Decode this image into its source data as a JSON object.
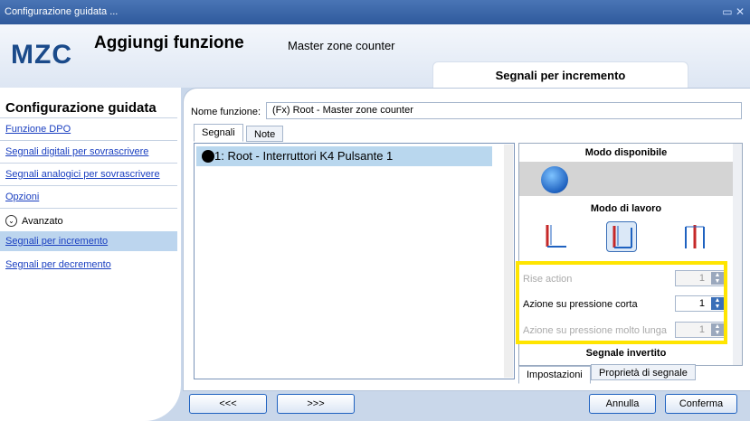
{
  "window": {
    "title": "Configurazione guidata ..."
  },
  "header": {
    "logo": "MZC",
    "title": "Aggiungi funzione",
    "subtitle": "Master zone counter",
    "step": "Segnali per incremento"
  },
  "sidebar": {
    "title": "Configurazione guidata",
    "items": [
      "Funzione DPO",
      "Segnali digitali per sovrascrivere",
      "Segnali analogici per sovrascrivere",
      "Opzioni"
    ],
    "advanced": "Avanzato",
    "advanced_items": [
      "Segnali per incremento",
      "Segnali per decremento"
    ]
  },
  "form": {
    "name_label": "Nome funzione:",
    "name_value": "(Fx) Root - Master zone counter"
  },
  "tabs": [
    "Segnali",
    "Note"
  ],
  "tree": {
    "row": "1: Root - Interruttori K4 Pulsante 1"
  },
  "panel": {
    "modo_disponibile": "Modo disponibile",
    "modo_lavoro": "Modo di lavoro",
    "fields": [
      {
        "label": "Rise action",
        "value": "1",
        "enabled": false
      },
      {
        "label": "Azione su pressione corta",
        "value": "1",
        "enabled": true
      },
      {
        "label": "Azione su pressione molto lunga",
        "value": "1",
        "enabled": false
      }
    ],
    "segnale": "Segnale invertito",
    "tabs": [
      "Impostazioni",
      "Proprietà di segnale"
    ]
  },
  "footer": {
    "prev": "<<<",
    "next": ">>>",
    "cancel": "Annulla",
    "confirm": "Conferma"
  },
  "colors": {
    "accent": "#1f62c0",
    "highlight": "#ffe500"
  }
}
